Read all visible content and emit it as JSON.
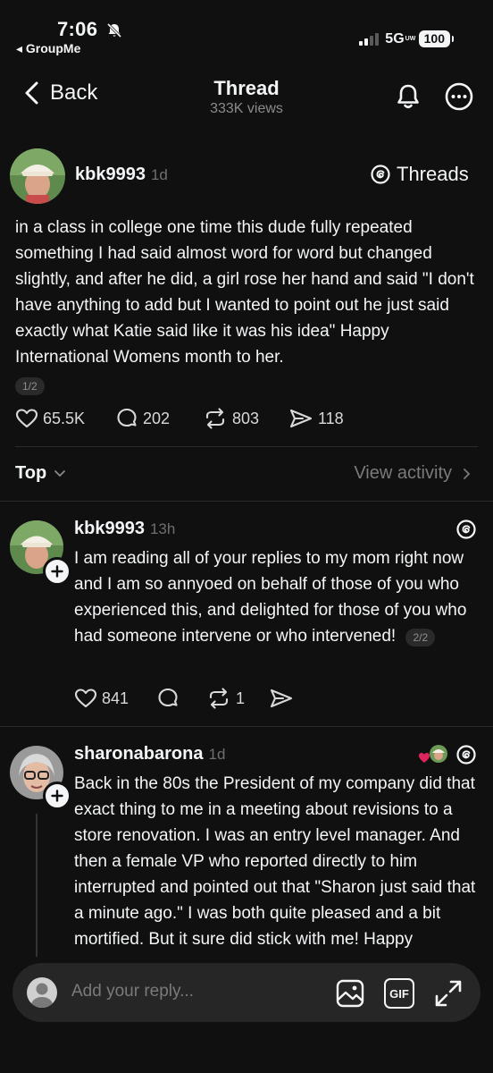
{
  "status_bar": {
    "time": "7:06",
    "back_app": "◂ GroupMe",
    "network": "5G",
    "network_sup": "UW",
    "battery": "100"
  },
  "nav": {
    "back_label": "Back",
    "title": "Thread",
    "views": "333K views"
  },
  "post": {
    "username": "kbk9993",
    "time": "1d",
    "threads_label": "Threads",
    "text": "in a class in college one time this dude fully repeated something I had said almost word for word but changed slightly, and after he did, a girl rose her hand and said \"I don't have anything to add but I wanted to point out he just said exactly what Katie said like it was his idea\" Happy International Womens month to her.",
    "page": "1/2",
    "likes": "65.5K",
    "comments": "202",
    "reposts": "803",
    "shares": "118"
  },
  "sort": {
    "label": "Top",
    "view_activity": "View activity"
  },
  "replies": [
    {
      "username": "kbk9993",
      "time": "13h",
      "text": "I am reading all of your replies to my mom right now and I am so annyoed on behalf of those of you who experienced this, and delighted for those of you who had someone intervene or who intervened!",
      "page": "2/2",
      "likes": "841",
      "reposts": "1"
    },
    {
      "username": "sharonabarona",
      "time": "1d",
      "text": "Back in the 80s the President of my company did that exact thing to me in a meeting about revisions to a store renovation. I was an entry level manager. And then a female VP who reported directly to him interrupted and pointed out that \"Sharon just said that a minute ago.\" I was both quite pleased and a bit mortified. But it sure did stick with me! Happy International"
    }
  ],
  "reply_bar": {
    "placeholder": "Add your reply...",
    "gif_label": "GIF"
  },
  "colors": {
    "background": "#101010",
    "text": "#f3f5f7",
    "muted": "#6f6f6f",
    "like_heart": "#e0245e"
  }
}
